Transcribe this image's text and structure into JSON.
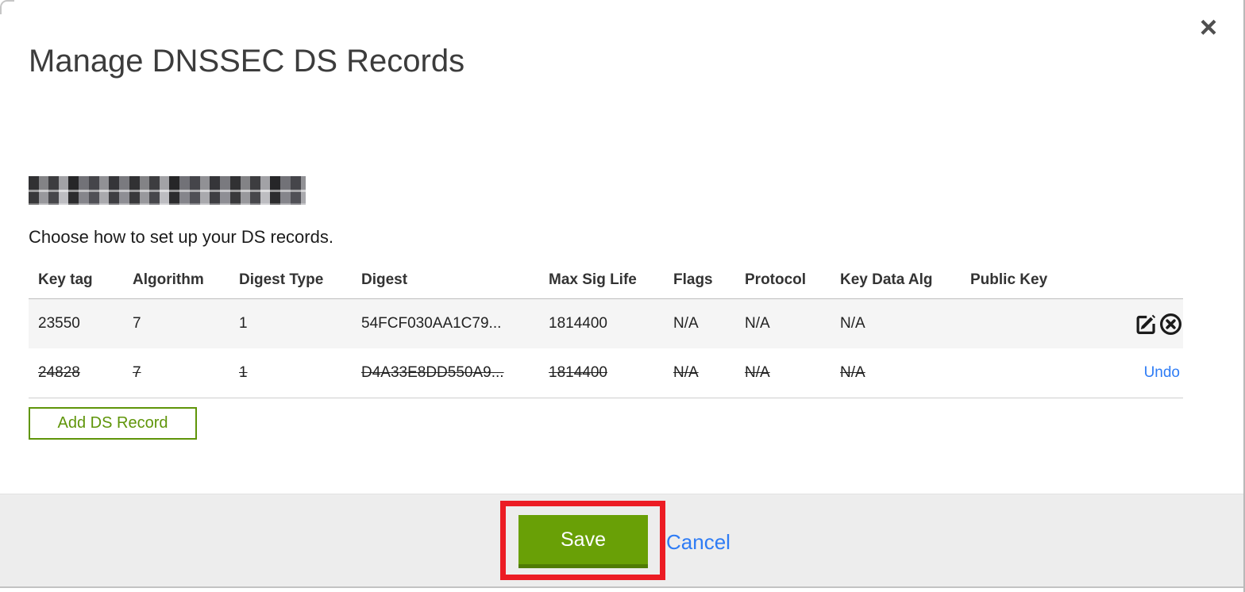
{
  "window": {
    "title": "Manage DNSSEC DS Records",
    "close_icon": "×"
  },
  "intro": {
    "text": "Choose how to set up your DS records."
  },
  "table": {
    "columns": [
      "Key tag",
      "Algorithm",
      "Digest Type",
      "Digest",
      "Max Sig Life",
      "Flags",
      "Protocol",
      "Key Data Alg",
      "Public Key"
    ],
    "rows": [
      {
        "key_tag": "23550",
        "algorithm": "7",
        "digest_type": "1",
        "digest": "54FCF030AA1C79...",
        "max_sig_life": "1814400",
        "flags": "N/A",
        "protocol": "N/A",
        "key_data_alg": "N/A",
        "public_key": "",
        "state": "active",
        "action_icons": [
          "edit-icon",
          "delete-icon"
        ]
      },
      {
        "key_tag": "24828",
        "algorithm": "7",
        "digest_type": "1",
        "digest": "D4A33E8DD550A9...",
        "max_sig_life": "1814400",
        "flags": "N/A",
        "protocol": "N/A",
        "key_data_alg": "N/A",
        "public_key": "",
        "state": "marked-for-deletion",
        "undo_label": "Undo"
      }
    ]
  },
  "buttons": {
    "add_ds_record": "Add DS Record",
    "save": "Save",
    "cancel": "Cancel"
  },
  "annotation": {
    "type": "highlight-box",
    "target": "save-button"
  },
  "colors": {
    "primary_green": "#69A006",
    "green_shadow": "#507C05",
    "outline_green": "#5F9509",
    "link_blue": "#2E7CF5",
    "annotation_red": "#EC1C24",
    "row_alt_gray": "#F5F5F5",
    "footer_gray": "#EDEDED"
  }
}
